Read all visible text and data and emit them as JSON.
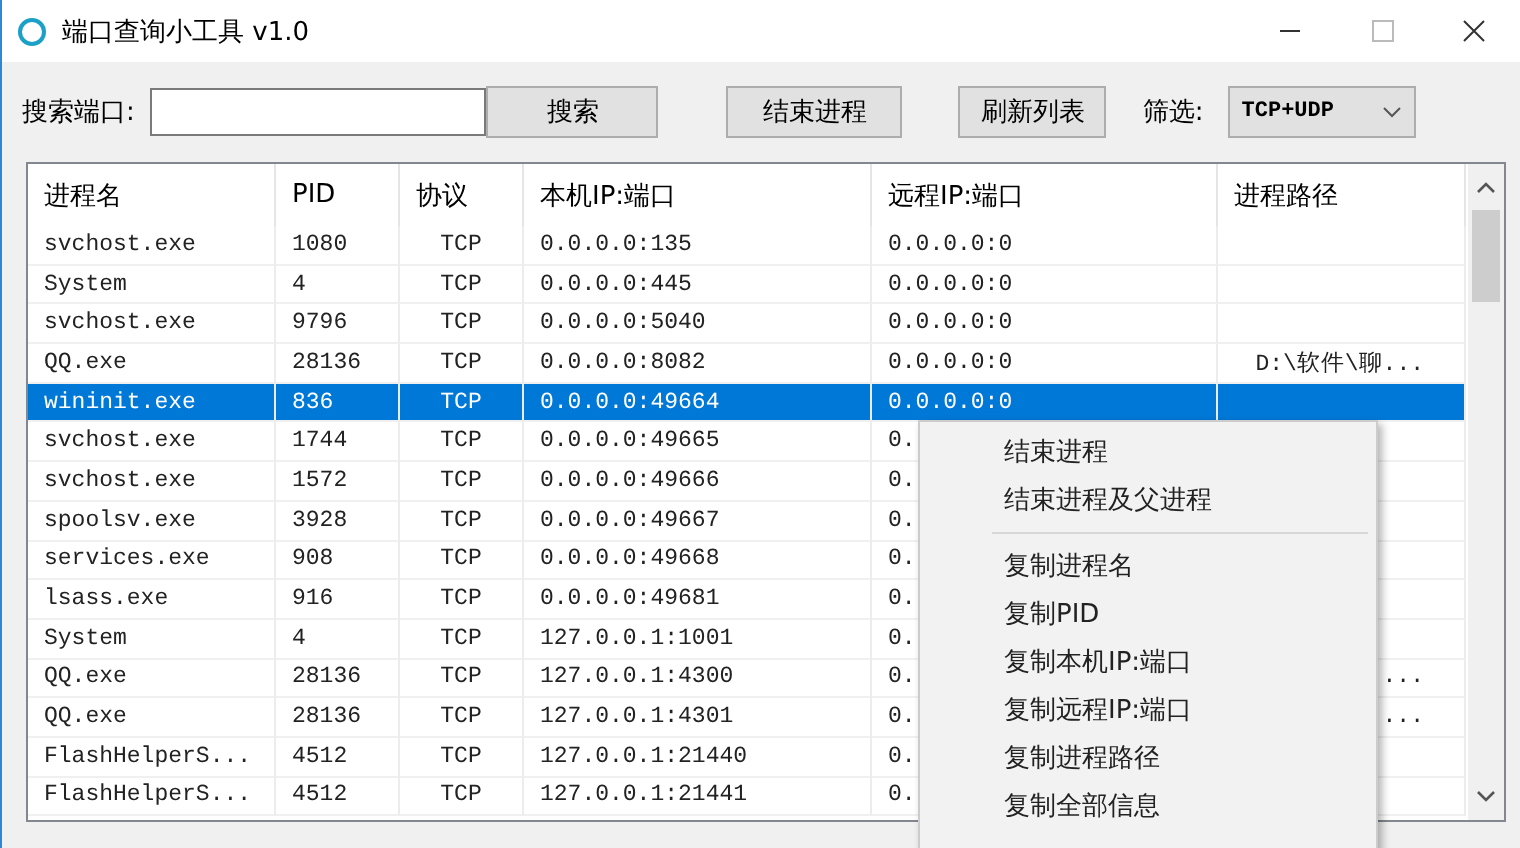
{
  "window": {
    "title": "端口查询小工具 v1.0"
  },
  "toolbar": {
    "search_label": "搜索端口:",
    "search_button": "搜索",
    "kill_button": "结束进程",
    "refresh_button": "刷新列表",
    "filter_label": "筛选:",
    "filter_value": "TCP+UDP"
  },
  "table": {
    "columns": [
      "进程名",
      "PID",
      "协议",
      "本机IP:端口",
      "远程IP:端口",
      "进程路径"
    ],
    "rows": [
      {
        "cells": [
          "svchost.exe",
          "1080",
          "TCP",
          "0.0.0.0:135",
          "0.0.0.0:0",
          ""
        ],
        "selected": false
      },
      {
        "cells": [
          "System",
          "4",
          "TCP",
          "0.0.0.0:445",
          "0.0.0.0:0",
          ""
        ],
        "selected": false
      },
      {
        "cells": [
          "svchost.exe",
          "9796",
          "TCP",
          "0.0.0.0:5040",
          "0.0.0.0:0",
          ""
        ],
        "selected": false
      },
      {
        "cells": [
          "QQ.exe",
          "28136",
          "TCP",
          "0.0.0.0:8082",
          "0.0.0.0:0",
          "D:\\软件\\聊..."
        ],
        "selected": false
      },
      {
        "cells": [
          "wininit.exe",
          "836",
          "TCP",
          "0.0.0.0:49664",
          "0.0.0.0:0",
          ""
        ],
        "selected": true
      },
      {
        "cells": [
          "svchost.exe",
          "1744",
          "TCP",
          "0.0.0.0:49665",
          "0.",
          ""
        ],
        "selected": false
      },
      {
        "cells": [
          "svchost.exe",
          "1572",
          "TCP",
          "0.0.0.0:49666",
          "0.",
          ""
        ],
        "selected": false
      },
      {
        "cells": [
          "spoolsv.exe",
          "3928",
          "TCP",
          "0.0.0.0:49667",
          "0.",
          ""
        ],
        "selected": false
      },
      {
        "cells": [
          "services.exe",
          "908",
          "TCP",
          "0.0.0.0:49668",
          "0.",
          ""
        ],
        "selected": false
      },
      {
        "cells": [
          "lsass.exe",
          "916",
          "TCP",
          "0.0.0.0:49681",
          "0.",
          ""
        ],
        "selected": false
      },
      {
        "cells": [
          "System",
          "4",
          "TCP",
          "127.0.0.1:1001",
          "0.",
          ""
        ],
        "selected": false
      },
      {
        "cells": [
          "QQ.exe",
          "28136",
          "TCP",
          "127.0.0.1:4300",
          "0.",
          "..."
        ],
        "selected": false
      },
      {
        "cells": [
          "QQ.exe",
          "28136",
          "TCP",
          "127.0.0.1:4301",
          "0.",
          "..."
        ],
        "selected": false
      },
      {
        "cells": [
          "FlashHelperS...",
          "4512",
          "TCP",
          "127.0.0.1:21440",
          "0.",
          ""
        ],
        "selected": false
      },
      {
        "cells": [
          "FlashHelperS...",
          "4512",
          "TCP",
          "127.0.0.1:21441",
          "0.",
          ""
        ],
        "selected": false
      }
    ]
  },
  "context_menu": {
    "items": [
      {
        "kind": "item",
        "label": "结束进程"
      },
      {
        "kind": "item",
        "label": "结束进程及父进程"
      },
      {
        "kind": "separator"
      },
      {
        "kind": "item",
        "label": "复制进程名"
      },
      {
        "kind": "item",
        "label": "复制PID"
      },
      {
        "kind": "item",
        "label": "复制本机IP:端口"
      },
      {
        "kind": "item",
        "label": "复制远程IP:端口"
      },
      {
        "kind": "item",
        "label": "复制进程路径"
      },
      {
        "kind": "item",
        "label": "复制全部信息"
      }
    ]
  }
}
